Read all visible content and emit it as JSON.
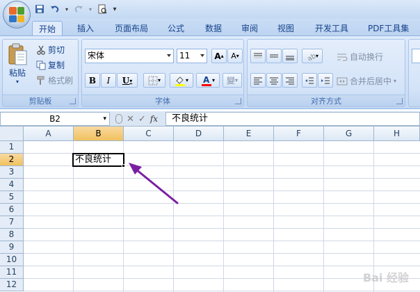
{
  "quick_access": {
    "icons": [
      "save-icon",
      "undo-icon",
      "redo-icon",
      "print-preview-icon",
      "customize-icon"
    ]
  },
  "tabs": [
    {
      "label": "开始",
      "active": true
    },
    {
      "label": "插入"
    },
    {
      "label": "页面布局"
    },
    {
      "label": "公式"
    },
    {
      "label": "数据"
    },
    {
      "label": "审阅"
    },
    {
      "label": "视图"
    },
    {
      "label": "开发工具"
    },
    {
      "label": "PDF工具集"
    }
  ],
  "clipboard": {
    "group_label": "剪贴板",
    "paste_label": "粘贴",
    "cut_label": "剪切",
    "copy_label": "复制",
    "format_painter_label": "格式刷"
  },
  "font": {
    "group_label": "字体",
    "font_name": "宋体",
    "font_size": "11",
    "bold": "B",
    "italic": "I",
    "underline": "U",
    "font_color": "#ff0000",
    "fill_color": "#ffff00",
    "phonetic": "變",
    "grow": "A",
    "shrink": "A"
  },
  "alignment": {
    "group_label": "对齐方式",
    "wrap_text_label": "自动换行",
    "merge_center_label": "合并后居中"
  },
  "formula_bar": {
    "name_box": "B2",
    "fx_label": "fx",
    "content": "不良统计"
  },
  "sheet": {
    "columns": [
      "A",
      "B",
      "C",
      "D",
      "E",
      "F",
      "G",
      "H"
    ],
    "rows": [
      "1",
      "2",
      "3",
      "4",
      "5",
      "6",
      "7",
      "8",
      "9",
      "10",
      "11",
      "12"
    ],
    "selected_column": "B",
    "selected_row": "2",
    "active_cell_value": "不良统计"
  },
  "annotation": {
    "arrow_color": "#7b1fa2"
  },
  "watermark": "Bai 经验"
}
